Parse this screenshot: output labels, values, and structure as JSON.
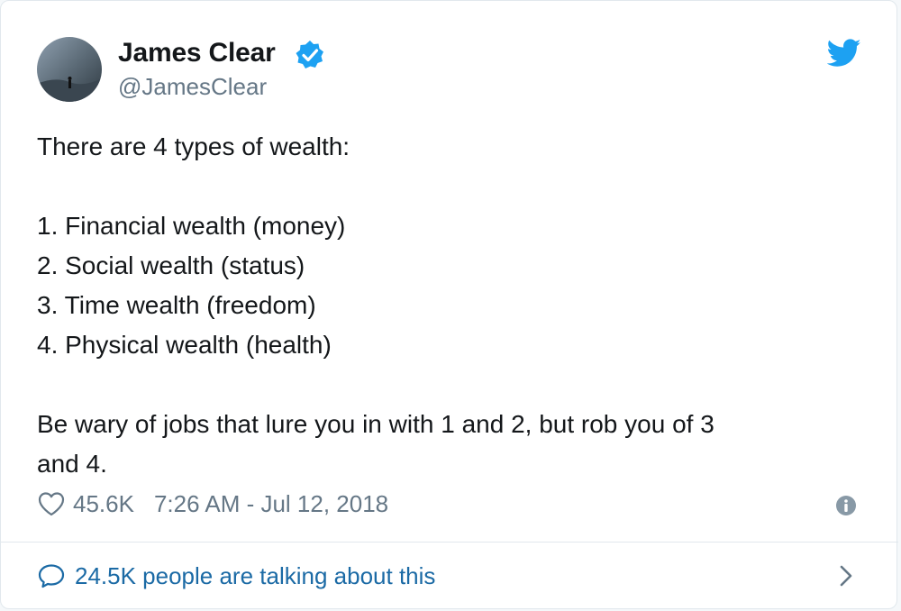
{
  "author": {
    "name": "James Clear",
    "handle": "@JamesClear",
    "avatar_icon": "avatar-photo",
    "verified_icon": "verified-badge-icon"
  },
  "tweet": {
    "intro": "There are 4 types of wealth:",
    "list": [
      "1. Financial wealth (money)",
      "2. Social wealth (status)",
      "3. Time wealth (freedom)",
      "4. Physical wealth (health)"
    ],
    "closing_line1": "Be wary of jobs that lure you in with 1 and 2, but rob you of 3",
    "closing_line2": "and 4."
  },
  "meta": {
    "likes": "45.6K",
    "timestamp": "7:26 AM - Jul 12, 2018"
  },
  "footer": {
    "talking": "24.5K people are talking about this"
  },
  "colors": {
    "brand_blue": "#1da1f2",
    "link_blue": "#1b6aa5",
    "muted_gray": "#657786",
    "text": "#14171a"
  }
}
